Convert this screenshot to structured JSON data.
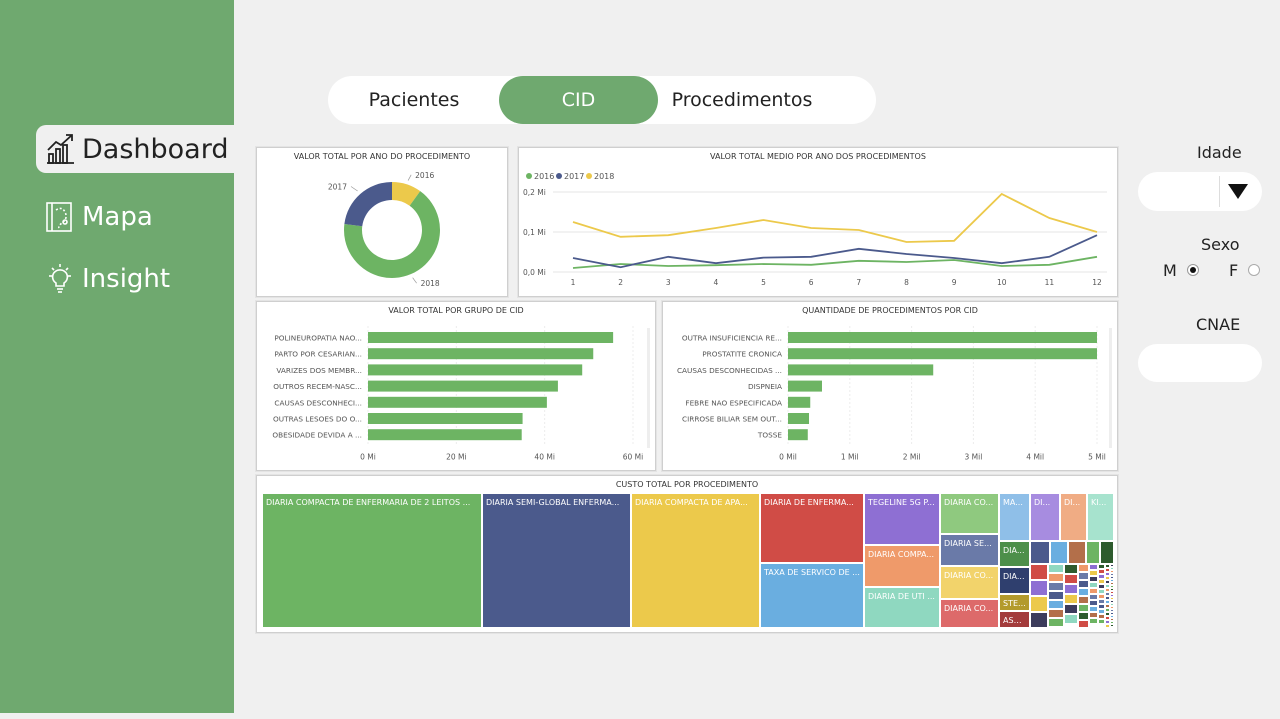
{
  "sidebar": {
    "items": [
      {
        "label": "Dashboard",
        "icon": "chart-up-icon"
      },
      {
        "label": "Mapa",
        "icon": "map-icon"
      },
      {
        "label": "Insight",
        "icon": "lightbulb-icon"
      }
    ]
  },
  "tabs": [
    {
      "label": "Pacientes",
      "active": false
    },
    {
      "label": "CID",
      "active": true
    },
    {
      "label": "Procedimentos",
      "active": false
    }
  ],
  "filters": {
    "idade_label": "Idade",
    "sexo_label": "Sexo",
    "sexo_options": [
      {
        "label": "M",
        "selected": true
      },
      {
        "label": "F",
        "selected": false
      }
    ],
    "cnae_label": "CNAE"
  },
  "colors": {
    "sidebar": "#6fa96f",
    "green": "#6db463",
    "navy": "#4b5a8c",
    "yellow": "#ecc94b"
  },
  "charts": {
    "donut": {
      "title": "VALOR TOTAL POR ANO DO PROCEDIMENTO",
      "chart_data": {
        "type": "pie",
        "categories": [
          "2016",
          "2017",
          "2018"
        ],
        "values": [
          10,
          23,
          67
        ]
      }
    },
    "line": {
      "title": "VALOR TOTAL MEDIO POR ANO DOS PROCEDIMENTOS",
      "chart_data": {
        "type": "line",
        "x": [
          1,
          2,
          3,
          4,
          5,
          6,
          7,
          8,
          9,
          10,
          11,
          12
        ],
        "yticks": [
          "0,0 Mi",
          "0,1 Mi",
          "0,2 Mi"
        ],
        "ylim": [
          0,
          0.2
        ],
        "legend_position": "top-left",
        "series": [
          {
            "name": "2016",
            "values": [
              0.01,
              0.02,
              0.015,
              0.017,
              0.02,
              0.018,
              0.028,
              0.025,
              0.03,
              0.015,
              0.018,
              0.038
            ]
          },
          {
            "name": "2017",
            "values": [
              0.035,
              0.012,
              0.038,
              0.022,
              0.036,
              0.038,
              0.058,
              0.045,
              0.035,
              0.022,
              0.038,
              0.092
            ]
          },
          {
            "name": "2018",
            "values": [
              0.125,
              0.088,
              0.092,
              0.11,
              0.13,
              0.11,
              0.105,
              0.075,
              0.078,
              0.195,
              0.135,
              0.1
            ]
          }
        ]
      }
    },
    "grupo": {
      "title": "VALOR TOTAL POR GRUPO DE CID",
      "chart_data": {
        "type": "bar",
        "orientation": "horizontal",
        "categories": [
          "POLINEUROPATIA NAO...",
          "PARTO POR CESARIAN...",
          "VARIZES DOS MEMBR...",
          "OUTROS RECEM-NASC...",
          "CAUSAS DESCONHECI...",
          "OUTRAS LESOES DO O...",
          "OBESIDADE DEVIDA A ..."
        ],
        "values": [
          55.5,
          51,
          48.5,
          43,
          40.5,
          35,
          34.8
        ],
        "xticks": [
          "0 Mi",
          "20 Mi",
          "40 Mi",
          "60 Mi"
        ],
        "xlim": [
          0,
          60
        ]
      }
    },
    "qtd": {
      "title": "QUANTIDADE DE PROCEDIMENTOS POR CID",
      "chart_data": {
        "type": "bar",
        "orientation": "horizontal",
        "categories": [
          "OUTRA INSUFICIENCIA RE...",
          "PROSTATITE CRONICA",
          "CAUSAS DESCONHECIDAS ...",
          "DISPNEIA",
          "FEBRE NAO ESPECIFICADA",
          "CIRROSE BILIAR SEM OUT...",
          "TOSSE"
        ],
        "values": [
          5,
          5,
          2.35,
          0.55,
          0.36,
          0.34,
          0.32
        ],
        "xticks": [
          "0 Mil",
          "1 Mil",
          "2 Mil",
          "3 Mil",
          "4 Mil",
          "5 Mil"
        ],
        "xlim": [
          0,
          5
        ]
      }
    },
    "treemap": {
      "title": "CUSTO TOTAL POR PROCEDIMENTO",
      "labels": [
        "DIARIA COMPACTA DE ENFERMARIA DE 2 LEITOS ...",
        "DIARIA SEMI-GLOBAL ENFERMA...",
        "DIARIA COMPACTA DE APA...",
        "DIARIA DE ENFERMA...",
        "TAXA DE SERVICO DE ...",
        "TEGELINE 5G P...",
        "DIARIA COMPA...",
        "DIARIA DE UTI ...",
        "DIARIA CO...",
        "DIARIA SE...",
        "DIARIA CO...",
        "DIARIA CO...",
        "MA...",
        "DI...",
        "DI...",
        "KI...",
        "DIA...",
        "DIA...",
        "STE...",
        "ASS..."
      ]
    }
  }
}
